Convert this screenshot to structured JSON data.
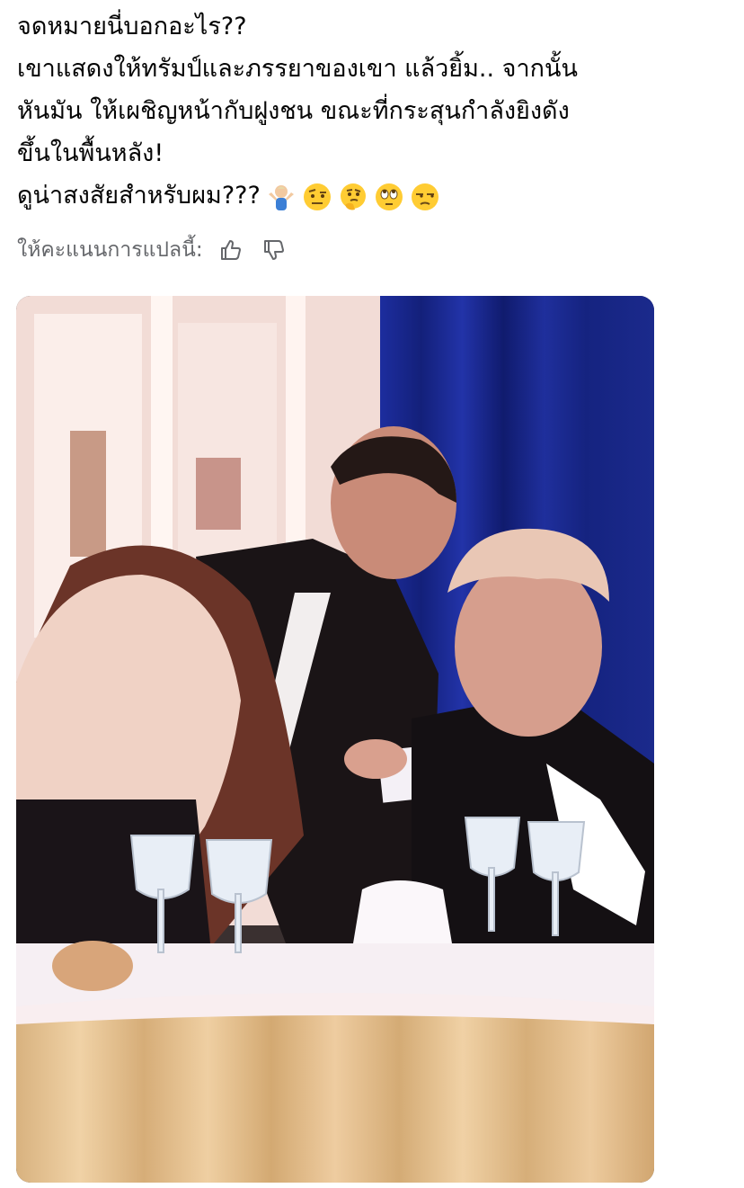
{
  "post": {
    "lines": [
      "จดหมายนี่บอกอะไร??",
      "เขาแสดงให้ทรัมป์และภรรยาของเขา แล้วยิ้ม.. จากนั้น",
      "หันมัน ให้เผชิญหน้ากับฝูงชน ขณะที่กระสุนกำลังยิงดัง",
      "ขึ้นในพื้นหลัง!",
      "ดูน่าสงสัยสำหรับผม???"
    ],
    "emojis": [
      "person-shrugging-emoji",
      "face-with-raised-eyebrow-emoji",
      "thinking-face-emoji",
      "face-with-rolling-eyes-emoji",
      "unamused-face-emoji"
    ]
  },
  "translation_rating": {
    "label": "ให้คะแนนการแปลนี้:",
    "icons": [
      "thumbs-up-icon",
      "thumbs-down-icon"
    ]
  },
  "photo": {
    "subject": "photo-of-dinner-table-scene"
  },
  "colors": {
    "text": "#050505",
    "secondary": "#65676b",
    "curtain": "#1b2a8c",
    "tablecloth": "#e6c79a"
  }
}
